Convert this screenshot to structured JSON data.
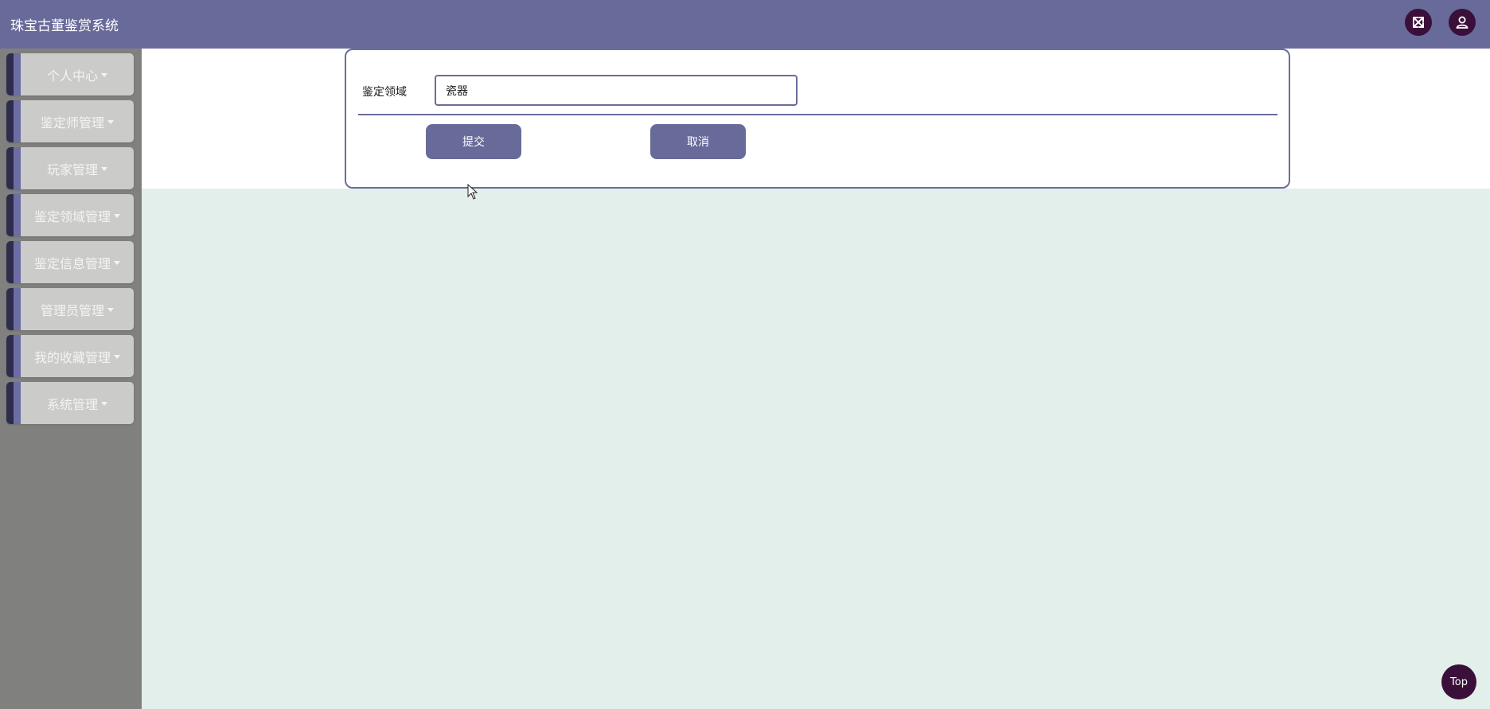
{
  "header": {
    "title": "珠宝古董鉴赏系统",
    "fullscreen_icon": "expand-icon",
    "user_icon": "user-icon",
    "bg_color": "#686a99"
  },
  "sidebar": {
    "items": [
      {
        "label": "个人中心"
      },
      {
        "label": "鉴定师管理"
      },
      {
        "label": "玩家管理"
      },
      {
        "label": "鉴定领域管理"
      },
      {
        "label": "鉴定信息管理"
      },
      {
        "label": "管理员管理"
      },
      {
        "label": "我的收藏管理"
      },
      {
        "label": "系统管理"
      }
    ]
  },
  "form": {
    "field_label": "鉴定领域",
    "field_value": "瓷器",
    "submit_label": "提交",
    "cancel_label": "取消"
  },
  "back_to_top": {
    "label": "Top"
  },
  "colors": {
    "accent": "#686a99",
    "dark_button": "#3a0f3a",
    "page_bg": "#e3efeb",
    "sidebar_bg": "#80807e"
  }
}
